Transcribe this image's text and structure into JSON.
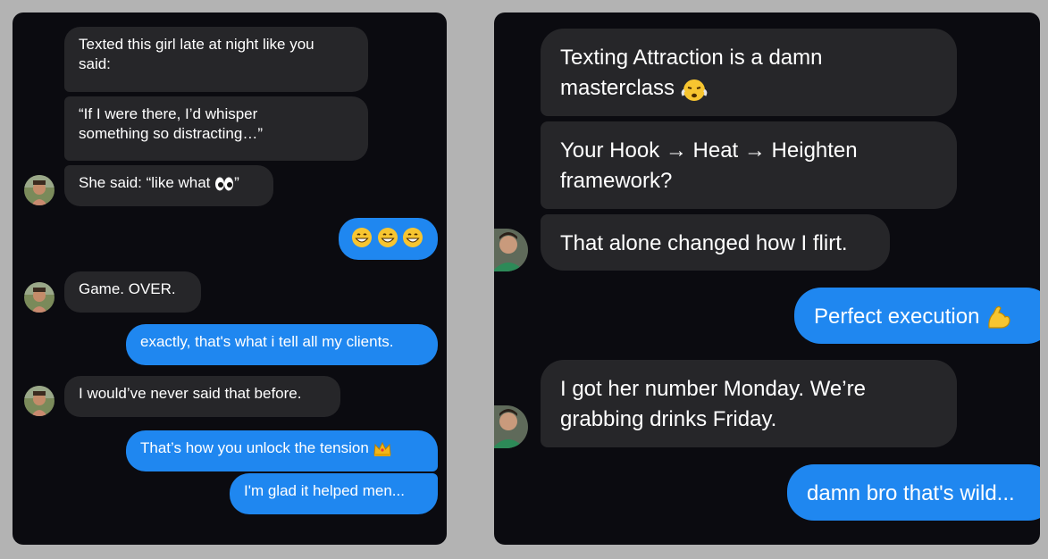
{
  "left_chat": {
    "messages": [
      {
        "id": "l1",
        "side": "in",
        "text": "Texted this girl late at night like you said:"
      },
      {
        "id": "l2",
        "side": "in",
        "text": "“If I were there, I’d whisper something so distracting…”"
      },
      {
        "id": "l3",
        "side": "in",
        "text": "She said: “like what ",
        "emoji_after": "eyes",
        "text_after": "”"
      },
      {
        "id": "l4",
        "side": "out",
        "emojis": [
          "grinning-face",
          "grinning-face",
          "grinning-face"
        ]
      },
      {
        "id": "l5",
        "side": "in",
        "text": "Game. OVER."
      },
      {
        "id": "l6",
        "side": "out",
        "text": "exactly, that's what i tell all my clients."
      },
      {
        "id": "l7",
        "side": "in",
        "text": "I would’ve never said that before."
      },
      {
        "id": "l8",
        "side": "out",
        "text": "That’s how you unlock the tension ",
        "emoji": "crown"
      },
      {
        "id": "l9",
        "side": "out",
        "text": "I'm glad it helped men..."
      }
    ],
    "line1_a": "Texted this girl late at night like you",
    "line1_b": "said:",
    "line2_a": "“If I were there, I’d whisper",
    "line2_b": "something so distracting…”"
  },
  "right_chat": {
    "messages": [
      {
        "id": "r1",
        "side": "in",
        "text": "Texting Attraction is a damn masterclass",
        "emoji": "face-blowing-steam"
      },
      {
        "id": "r2",
        "side": "in",
        "text": "Your Hook → Heat → Heighten framework?"
      },
      {
        "id": "r3",
        "side": "in",
        "text": "That alone changed how I flirt."
      },
      {
        "id": "r4",
        "side": "out",
        "text": "Perfect execution",
        "emoji": "flexed-biceps"
      },
      {
        "id": "r5",
        "side": "in",
        "text": "I got her number Monday. We’re grabbing drinks Friday."
      },
      {
        "id": "r6",
        "side": "out",
        "text": "damn bro that's wild..."
      }
    ],
    "r1_a": "Texting Attraction is a damn",
    "r1_b": "masterclass",
    "r2_a": "Your Hook → Heat → Heighten",
    "r2_b": "framework?",
    "r5_a": "I got her number Monday. We’re",
    "r5_b": "grabbing drinks Friday."
  },
  "colors": {
    "background": "#b3b3b3",
    "panel": "#0b0b10",
    "incoming_bubble": "#262629",
    "outgoing_bubble": "#1f87f0",
    "text": "#ffffff"
  },
  "icons": [
    "avatar",
    "eyes-emoji",
    "grinning-face-emoji",
    "crown-emoji",
    "face-blowing-steam-emoji",
    "flexed-biceps-emoji"
  ]
}
